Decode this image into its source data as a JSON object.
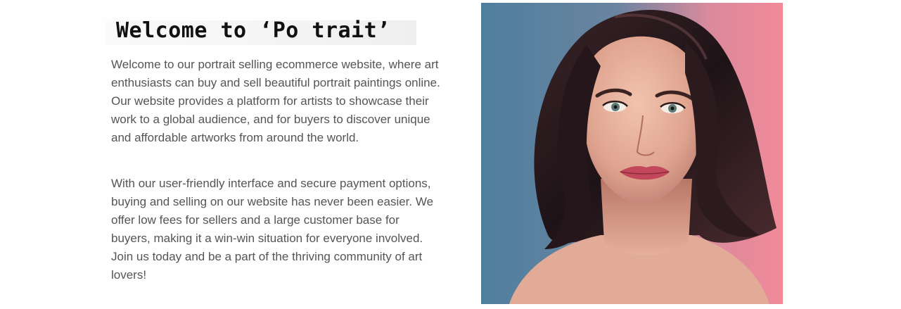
{
  "hero": {
    "title": "Welcome to ‘Po trait’",
    "paragraphs": [
      "Welcome to our portrait selling ecommerce website, where art enthusiasts can buy and sell beautiful portrait paintings online. Our website provides a platform for artists to showcase their work to a global audience, and for buyers to discover unique and affordable artworks from around the world.",
      "With our user-friendly interface and secure payment options, buying and selling on our website has never been easier. We offer low fees for sellers and a large customer base for buyers, making it a win-win situation for everyone involved. Join us today and be a part of the thriving community of art lovers!"
    ],
    "image": {
      "icon": "portrait-painting-image",
      "colors": {
        "background_left": "#4f7f9e",
        "background_right": "#f18a99",
        "hair": "#2a1a1d",
        "skin": "#e7b29e"
      }
    }
  }
}
